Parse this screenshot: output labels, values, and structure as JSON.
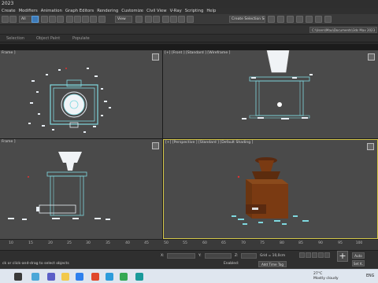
{
  "window": {
    "title": "2023"
  },
  "menu": [
    "Create",
    "Modifiers",
    "Animation",
    "Graph Editors",
    "Rendering",
    "Customize",
    "Civil View",
    "V-Ray",
    "Scripting",
    "Help"
  ],
  "toolbar": {
    "filter_dropdown": "All",
    "view_dropdown": "View",
    "selection_set_dropdown": "Create Selection Set"
  },
  "ribbon": {
    "path": "C:\\Users\\Mau\\Documents\\3ds Max 2023"
  },
  "subtabs": [
    "Selection",
    "Object Paint",
    "Populate"
  ],
  "viewports": {
    "top": {
      "label": "Frame ]"
    },
    "front": {
      "label": "[+] [Front ] [Standard ] [Wireframe ]"
    },
    "left": {
      "label": "Frame ]"
    },
    "perspective": {
      "label": "[+] [Perspective ] [Standard ] [Default Shading ]"
    }
  },
  "timeline": {
    "ticks": [
      10,
      15,
      20,
      25,
      30,
      35,
      40,
      45,
      50,
      55,
      60,
      65,
      70,
      75,
      80,
      85,
      90,
      95,
      100
    ]
  },
  "status": {
    "prompt": "ck or click-and-drag to select objects",
    "x_label": "X:",
    "y_label": "Y:",
    "z_label": "Z:",
    "grid": "Grid = 10,0cm",
    "enabled_label": "Enabled:",
    "add_time_tag": "Add Time Tag",
    "auto_key": "Auto",
    "set_key": "Set K."
  },
  "taskbar": {
    "weather_temp": "27°C",
    "weather_desc": "Mostly cloudy",
    "language": "ENG"
  },
  "colors": {
    "viewport_bg": "#4a4a4a",
    "active_border": "#d6c84a",
    "wire_cyan": "#7fd9e0",
    "scatter_white": "#e8eef5",
    "wood": "#7a3a12"
  }
}
